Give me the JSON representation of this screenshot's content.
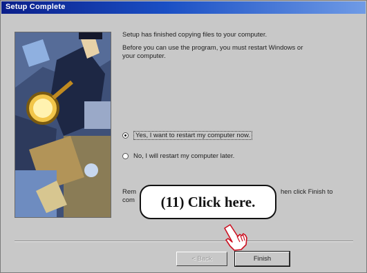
{
  "window": {
    "title": "Setup Complete"
  },
  "content": {
    "paragraph1": "Setup has finished copying files to your computer.",
    "paragraph2_line1": "Before you can use the program, you must restart Windows or",
    "paragraph2_line2": "your computer.",
    "radio_options": [
      {
        "label": "Yes, I want to restart my computer now.",
        "checked": true
      },
      {
        "label": "No, I will restart my computer later.",
        "checked": false
      }
    ],
    "instruction_left_line1": "Rem",
    "instruction_right_line1": "hen click Finish to",
    "instruction_left_line2": "com"
  },
  "buttons": {
    "back_label": "< Back",
    "finish_label": "Finish"
  },
  "annotation": {
    "callout_text": "(11)  Click here."
  },
  "icons": {
    "pointer": "pointing-hand-icon"
  },
  "colors": {
    "titlebar_start": "#0b1f8a",
    "titlebar_end": "#6f9be6",
    "dialog_bg": "#c8c8c8"
  }
}
